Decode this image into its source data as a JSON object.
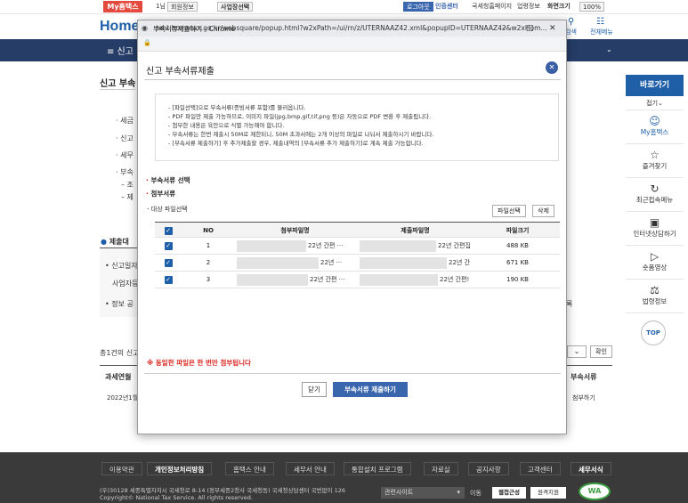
{
  "topbar": {
    "mytax_tab": "My홈택스",
    "chip_partial": "1님",
    "member_info": "회원정보",
    "business_select": "사업장선택",
    "logout": "로그아웃",
    "cert_center": "인증센터",
    "nts_home": "국세청홈페이지",
    "site_info": "업령정보",
    "zoom_label": "화면크기",
    "zoom_value": "100%"
  },
  "header": {
    "logo_text": "Home",
    "search_label": "검색",
    "all_menu_label": "전체메뉴"
  },
  "nav": {
    "menu_text": "≡ 신고"
  },
  "background": {
    "page_title": "신고 부속",
    "lines": [
      "· 세금",
      "· 신고",
      "· 세무",
      "· 부속",
      "– 조",
      "– 제"
    ],
    "submit_section": "제출대",
    "report_date_label": "• 신고일자",
    "business_label": "사업자등",
    "info_label": "• 정보 공",
    "count_text": "총1건의 신고",
    "tax_year_header": "과세연월",
    "row_date": "2022년1월",
    "attach_header": "부속서류",
    "attach_cell": "첨부하기",
    "right_suffix": "록",
    "confirm_button": "확인"
  },
  "quick_menu": {
    "title": "바로가기",
    "collapse": "접기⌄",
    "items": [
      {
        "label": "My홈택스",
        "icon": "person-icon"
      },
      {
        "label": "즐겨찾기",
        "icon": "star-icon"
      },
      {
        "label": "최근접속메뉴",
        "icon": "recent-icon"
      },
      {
        "label": "인터넷상담하기",
        "icon": "chat-icon"
      },
      {
        "label": "숏폼영상",
        "icon": "video-icon"
      },
      {
        "label": "법령정보",
        "icon": "law-icon"
      }
    ],
    "top_button": "TOP"
  },
  "footer": {
    "links": [
      "이용약관",
      "개인정보처리방침",
      "홈택스 안내",
      "세무서 안내",
      "통합설치 프로그램",
      "자료실",
      "공지사항",
      "고객센터",
      "세무서식"
    ],
    "address": "(우)30128 세종특별자치시 국세청로 8-14 (정부세종2청사 국세청동) 국세청상담센터 국번없이 126",
    "copyright": "Copyright© National Tax Service. All rights reserved.",
    "related_sites": "관련사이트",
    "move": "이동",
    "web_access": "웹접근성",
    "remote": "원격지원"
  },
  "popup": {
    "window_title": "부속서류제출하기 - Chrome",
    "url": "teht.hometax.go.kr/websquare/popup.html?w2xPath=/ui/rn/z/UTERNAAZ42.xml&popupID=UTERNAAZ42&w2xHom...",
    "title": "신고 부속서류제출",
    "notices": [
      "- [파일선택]으로 부속서류(증빙서류 포함)를 불러옵니다.",
      "- PDF 파일만 제출 가능하므로, 이미지 파일(jpg,bmp,gif,tif,png 등)은 자동으로 PDF 변환 후 제출됩니다.",
      "- 첨부한 내용은 육안으로 식별 가능해야 합니다.",
      "- 부속서류는 한번 제출시 50M로 제한되니, 50M 초과서에는 2개 이상의 파일로 나눠서 제출하시기 바랍니다.",
      "- [부속서류 제출하기] 후 추가제출할 경우, 제출내역의 [부속서류 추가 제출하기]로 계속 제출 가능합니다."
    ],
    "section_select": "부속서류 선택",
    "section_attach": "첨부서류",
    "target_label": "- 대상 파일선택",
    "select_file_button": "파일선택",
    "delete_button": "삭제",
    "table": {
      "headers": [
        "NO",
        "첨부파일명",
        "제출파일명",
        "파일크기"
      ],
      "rows": [
        {
          "no": "1",
          "attach": "22년 간편 ···",
          "submit": "22년 간편집",
          "size": "488 KB"
        },
        {
          "no": "2",
          "attach": "22년 ···",
          "submit": "22년 간",
          "size": "671 KB"
        },
        {
          "no": "3",
          "attach": "22년 간편 ···",
          "submit": "22년 간편!",
          "size": "190 KB"
        }
      ]
    },
    "warning": "※ 동일한 파일은 한 번만 첨부됩니다",
    "close_button": "닫기",
    "submit_button": "부속서류 제출하기"
  }
}
